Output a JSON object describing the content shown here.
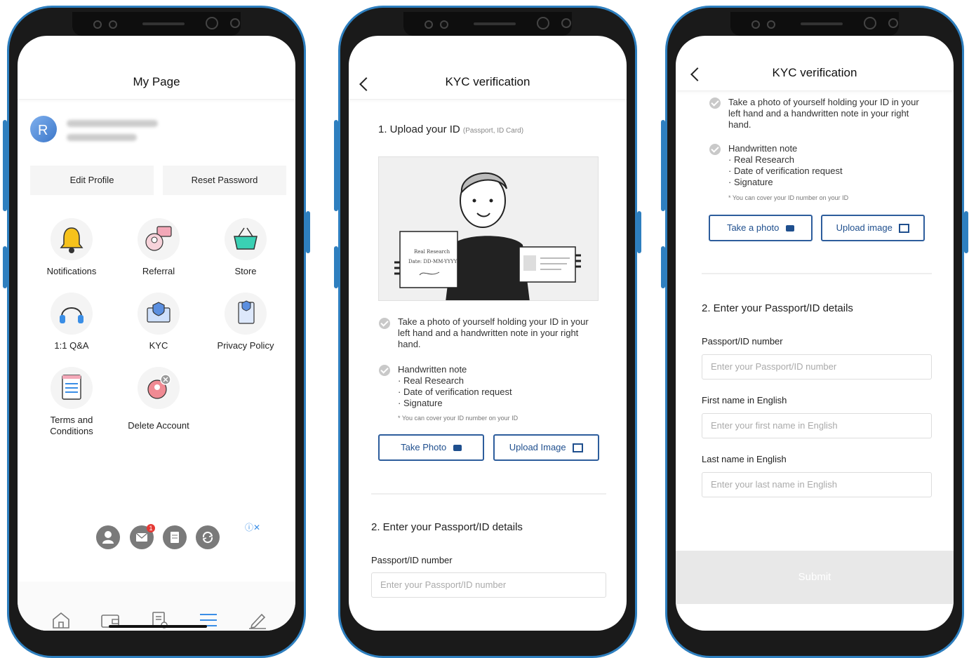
{
  "phone1": {
    "title": "My Page",
    "buttons": {
      "edit_profile": "Edit Profile",
      "reset_password": "Reset Password"
    },
    "menu": [
      {
        "label": "Notifications",
        "icon": "bell-icon"
      },
      {
        "label": "Referral",
        "icon": "referral-icon"
      },
      {
        "label": "Store",
        "icon": "basket-icon"
      },
      {
        "label": "1:1 Q&A",
        "icon": "headset-icon"
      },
      {
        "label": "KYC",
        "icon": "id-card-icon"
      },
      {
        "label": "Privacy Policy",
        "icon": "document-shield-icon"
      },
      {
        "label": "Terms and Conditions",
        "icon": "list-document-icon"
      },
      {
        "label": "Delete Account",
        "icon": "delete-user-icon"
      }
    ],
    "mail_badge": "1",
    "ad_info": "ⓘ✕"
  },
  "phone2": {
    "title": "KYC verification",
    "section1_title": "1. Upload your ID",
    "section1_hint": "(Passport, ID Card)",
    "note_lines": {
      "line1": "Real Research",
      "line2": "Date: DD-MM-YYYY"
    },
    "instruction1": "Take a photo of yourself holding your ID in your left hand and a handwritten note in your right hand.",
    "instruction2_title": "Handwritten note",
    "instruction2_items": [
      "· Real Research",
      "· Date of verification request",
      "· Signature"
    ],
    "instruction_footnote": "* You can cover your ID number on your ID",
    "take_photo": "Take Photo",
    "upload_image": "Upload Image",
    "section2_title": "2. Enter your Passport/ID details",
    "passport_label": "Passport/ID number",
    "passport_placeholder": "Enter your Passport/ID number"
  },
  "phone3": {
    "title": "KYC verification",
    "instruction1": "Take a photo of yourself holding your ID in your left hand and a handwritten note in your right hand.",
    "instruction2_title": "Handwritten note",
    "instruction2_items": [
      "· Real Research",
      "· Date of verification request",
      "· Signature"
    ],
    "instruction_footnote": "* You can cover your ID number on your ID",
    "take_photo": "Take a photo",
    "upload_image": "Upload image",
    "section2_title": "2. Enter your Passport/ID details",
    "passport_label": "Passport/ID number",
    "passport_placeholder": "Enter your Passport/ID number",
    "first_label": "First name in English",
    "first_placeholder": "Enter your first name in English",
    "last_label": "Last name in English",
    "last_placeholder": "Enter your last name in English",
    "submit": "Submit"
  },
  "colors": {
    "frame": "#2e7fbf",
    "accent": "#2d5d9c",
    "submit_bg": "#e8e8e8"
  }
}
